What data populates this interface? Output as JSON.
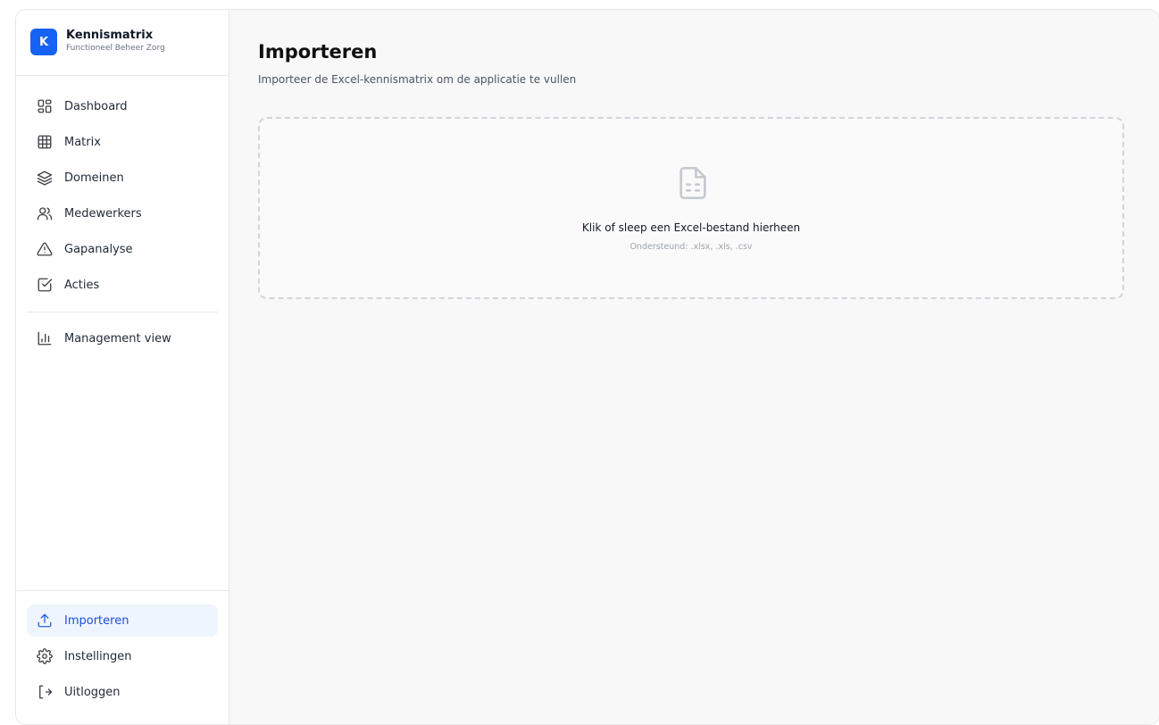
{
  "brand": {
    "logo_letter": "K",
    "name": "Kennismatrix",
    "subtitle": "Functioneel Beheer Zorg",
    "accent_color": "#1662f3"
  },
  "sidebar": {
    "items": [
      {
        "label": "Dashboard",
        "icon": "dashboard-icon"
      },
      {
        "label": "Matrix",
        "icon": "grid-icon"
      },
      {
        "label": "Domeinen",
        "icon": "layers-icon"
      },
      {
        "label": "Medewerkers",
        "icon": "users-icon"
      },
      {
        "label": "Gapanalyse",
        "icon": "warning-triangle-icon"
      },
      {
        "label": "Acties",
        "icon": "checkbox-icon"
      }
    ],
    "secondary_items": [
      {
        "label": "Management view",
        "icon": "bar-chart-icon"
      }
    ],
    "bottom_items": [
      {
        "label": "Importeren",
        "icon": "upload-icon",
        "active": true
      },
      {
        "label": "Instellingen",
        "icon": "gear-icon"
      },
      {
        "label": "Uitloggen",
        "icon": "logout-icon"
      }
    ]
  },
  "main": {
    "title": "Importeren",
    "subtitle": "Importeer de Excel-kennismatrix om de applicatie te vullen",
    "dropzone": {
      "icon": "spreadsheet-file-icon",
      "text": "Klik of sleep een Excel-bestand hierheen",
      "subtext": "Ondersteund: .xlsx, .xls, .csv"
    }
  }
}
